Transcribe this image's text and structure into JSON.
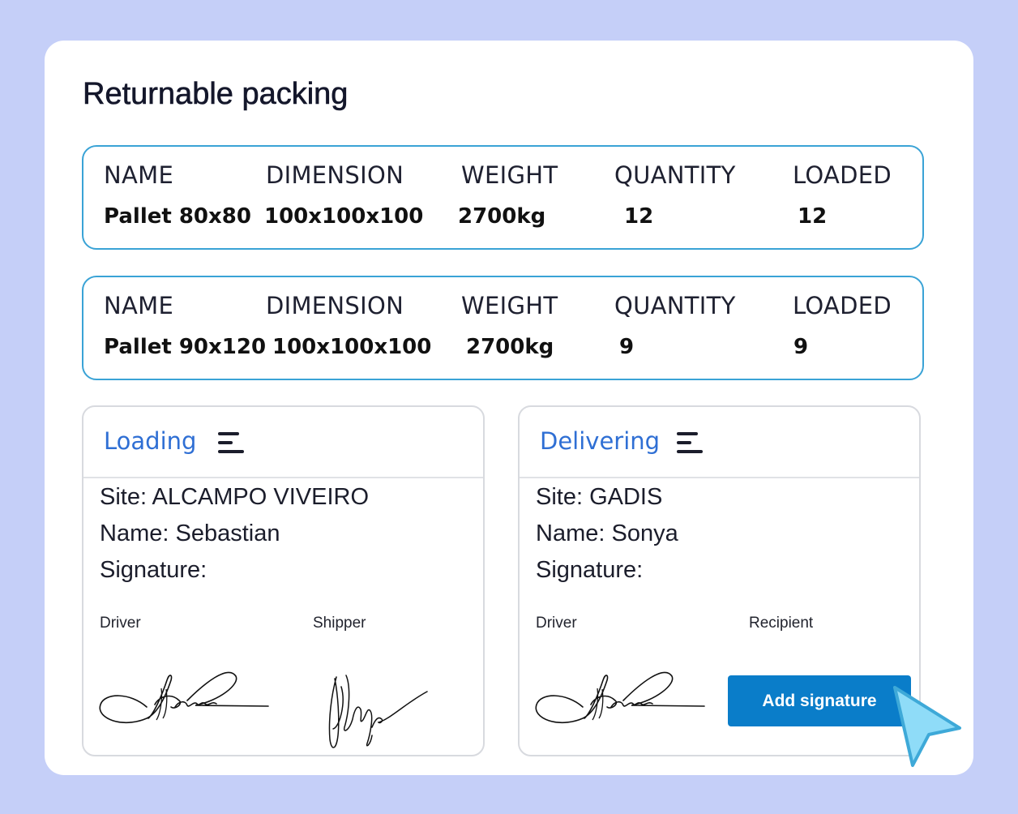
{
  "title": "Returnable packing",
  "columns": [
    "NAME",
    "DIMENSION",
    "WEIGHT",
    "QUANTITY",
    "LOADED"
  ],
  "items": [
    {
      "name": "Pallet 80x80",
      "dimension": "100x100x100",
      "weight": "2700kg",
      "quantity": "12",
      "loaded": "12"
    },
    {
      "name": "Pallet 90x120",
      "dimension": "100x100x100",
      "weight": "2700kg",
      "quantity": "9",
      "loaded": "9"
    }
  ],
  "loading": {
    "title": "Loading",
    "site": "Site: ALCAMPO VIVEIRO",
    "name": "Name: Sebastian",
    "signature_label": "Signature:",
    "party1": "Driver",
    "party2": "Shipper"
  },
  "delivering": {
    "title": "Delivering",
    "site": "Site: GADIS",
    "name": "Name: Sonya",
    "signature_label": "Signature:",
    "party1": "Driver",
    "party2": "Recipient",
    "add_signature": "Add signature"
  },
  "colors": {
    "background": "#c5cff8",
    "row_border": "#3aa3d6",
    "panel_title": "#2f6fd4",
    "button": "#0a7dc9",
    "cursor": "#7dd3f5"
  },
  "icons": [
    "menu-icon",
    "cursor-pointer-icon"
  ]
}
